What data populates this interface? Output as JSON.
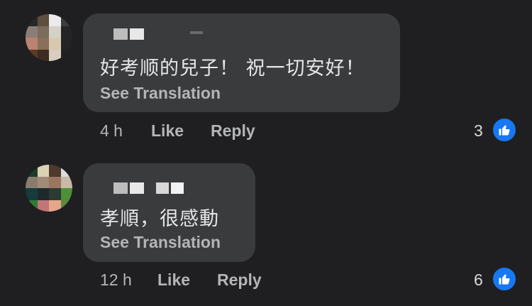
{
  "comments": [
    {
      "text": "好考顺的兒子！ 祝一切安好！",
      "see_translation": "See Translation",
      "time": "4 h",
      "like_label": "Like",
      "reply_label": "Reply",
      "reaction_count": "3",
      "reaction_icon": "thumbs-up-icon"
    },
    {
      "text": "孝順，很感動",
      "see_translation": "See Translation",
      "time": "12 h",
      "like_label": "Like",
      "reply_label": "Reply",
      "reaction_count": "6",
      "reaction_icon": "thumbs-up-icon"
    }
  ],
  "colors": {
    "background": "#1f1f21",
    "bubble": "#3a3b3c",
    "secondary_text": "#b4b5b8",
    "like_badge": "#1877f2"
  }
}
